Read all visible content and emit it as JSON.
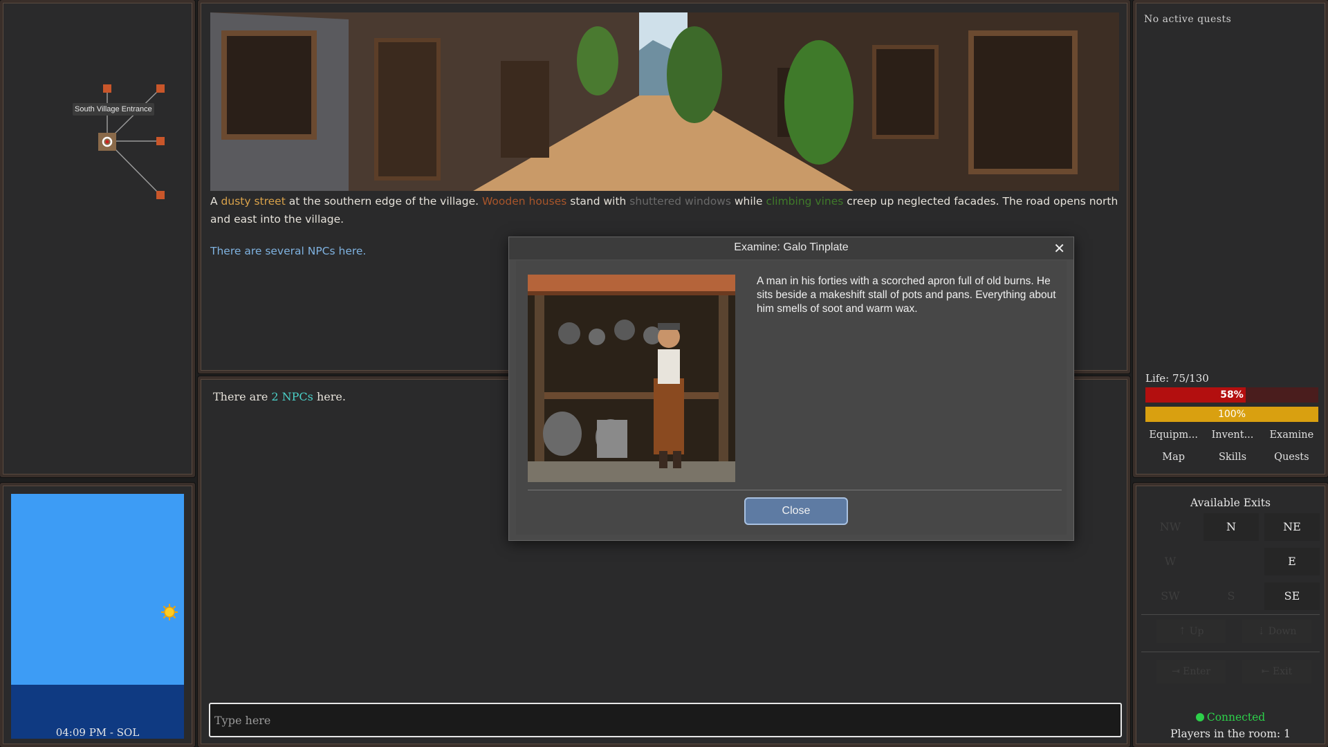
{
  "minimap": {
    "tooltip": "South Village Entrance"
  },
  "sky": {
    "clock": "04:09 PM - SOL"
  },
  "scene": {
    "description": {
      "p1": "A ",
      "dusty": "dusty street",
      "p2": " at the southern edge of the village. ",
      "wood": "Wooden houses",
      "p3": " stand with ",
      "shutter": "shuttered windows",
      "p4": " while ",
      "vines": "climbing vines",
      "p5": " creep up neglected facades. The road opens north and east into the village."
    },
    "npc_hint": "There are several NPCs here."
  },
  "log": {
    "prefix": "There are ",
    "npc_count": "2 NPCs",
    "suffix": " here."
  },
  "input": {
    "placeholder": "Type here"
  },
  "quests": {
    "title": "No active quests"
  },
  "stats": {
    "life_label": "Life: 75/130",
    "life_pct": 58,
    "life_text": "58%",
    "stamina_pct": 100,
    "stamina_text": "100%"
  },
  "tools": {
    "equipment": "Equipm...",
    "inventory": "Invent...",
    "examine": "Examine",
    "map": "Map",
    "skills": "Skills",
    "quests": "Quests"
  },
  "exits": {
    "title": "Available Exits",
    "nw": "NW",
    "n": "N",
    "ne": "NE",
    "w": "W",
    "e": "E",
    "sw": "SW",
    "s": "S",
    "se": "SE",
    "up": "⇡ Up",
    "down": "⇣ Down",
    "enter": "⇥ Enter",
    "exit": "⇤ Exit"
  },
  "connection": {
    "status": "Connected",
    "players": "Players in the room: 1"
  },
  "modal": {
    "title": "Examine: Galo Tinplate",
    "description": "A man in his forties with a scorched apron full of old burns. He sits beside a makeshift stall of pots and pans. Everything about him smells of soot and warm wax.",
    "close_label": "Close"
  },
  "colors": {
    "life": "#b30f0f",
    "stamina": "#d9a010",
    "connected": "#2dd04a",
    "npc_link": "#4bd0c8",
    "modal_button": "#5e7ba3"
  }
}
